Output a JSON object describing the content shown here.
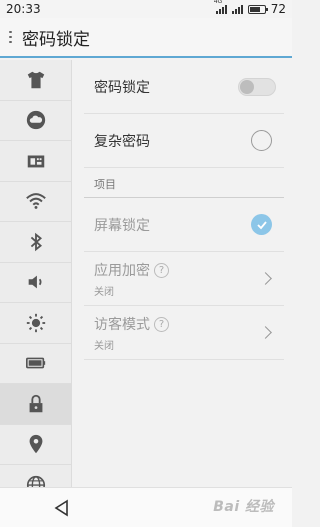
{
  "status_bar": {
    "time": "20:33",
    "network": "4G",
    "battery_level": 0.72,
    "battery_text": "72"
  },
  "header": {
    "title": "密码锁定"
  },
  "sidebar": {
    "items": [
      {
        "icon": "shirt-icon"
      },
      {
        "icon": "cloud-icon"
      },
      {
        "icon": "sim-card-icon"
      },
      {
        "icon": "wifi-icon"
      },
      {
        "icon": "bluetooth-icon"
      },
      {
        "icon": "volume-icon"
      },
      {
        "icon": "brightness-icon"
      },
      {
        "icon": "battery-icon"
      },
      {
        "icon": "lock-icon",
        "active": true
      },
      {
        "icon": "location-icon"
      },
      {
        "icon": "globe-icon"
      }
    ]
  },
  "main": {
    "password_lock": {
      "label": "密码锁定",
      "enabled": false
    },
    "complex_password": {
      "label": "复杂密码",
      "checked": false
    },
    "section_title": "项目",
    "items": [
      {
        "label": "屏幕锁定",
        "checked": true
      },
      {
        "label": "应用加密",
        "status": "关闭",
        "help": "?"
      },
      {
        "label": "访客模式",
        "status": "关闭",
        "help": "?"
      }
    ]
  },
  "nav": {
    "watermark": "Bai 经验"
  },
  "colors": {
    "accent": "#5fa8d3",
    "check": "#8cc6e8"
  }
}
